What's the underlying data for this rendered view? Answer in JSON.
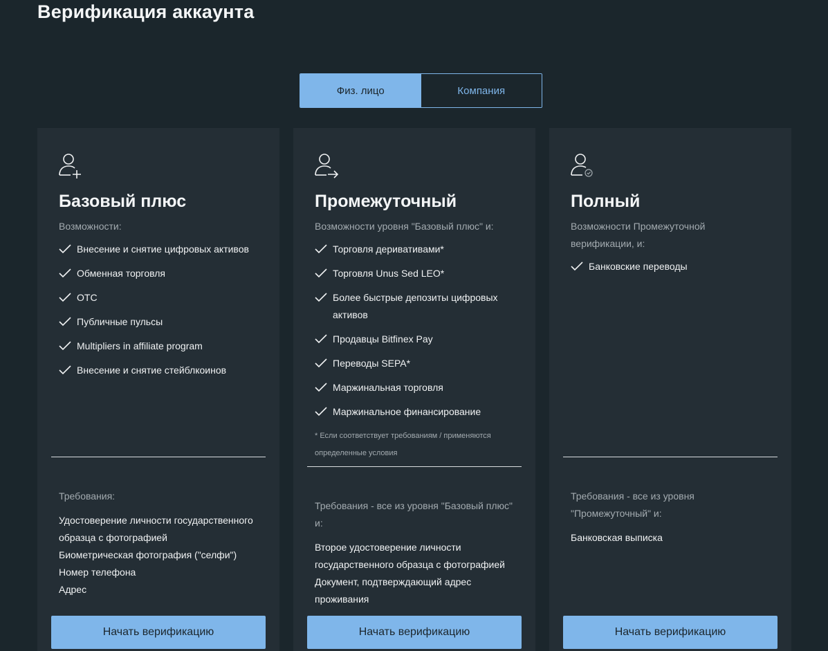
{
  "page": {
    "title": "Верификация аккаунта"
  },
  "tabs": [
    {
      "label": "Физ. лицо",
      "active": true
    },
    {
      "label": "Компания",
      "active": false
    }
  ],
  "colors": {
    "background": "#1b262c",
    "card": "#242e35",
    "accent": "#7fb6ea"
  },
  "cards": [
    {
      "icon": "user-plus-icon",
      "title": "Базовый плюс",
      "subtitle": "Возможности:",
      "features": [
        "Внесение и снятие цифровых активов",
        "Обменная торговля",
        "OTC",
        "Публичные пульсы",
        "Multipliers in affiliate program",
        "Внесение и снятие стейблкоинов"
      ],
      "footnote": "",
      "requirements_title": "Требования:",
      "requirements": [
        "Удостоверение личности государственного образца с фотографией",
        "Биометрическая фотография (\"селфи\")",
        "Номер телефона",
        "Адрес"
      ],
      "button": "Начать верификацию"
    },
    {
      "icon": "user-arrow-icon",
      "title": "Промежуточный",
      "subtitle": "Возможности уровня \"Базовый плюс\" и:",
      "features": [
        "Торговля деривативами*",
        "Торговля Unus Sed LEO*",
        "Более быстрые депозиты цифровых активов",
        "Продавцы Bitfinex Pay",
        "Переводы SEPA*",
        "Маржинальная торговля",
        "Маржинальное финансирование"
      ],
      "footnote": "* Если соответствует требованиям / применяются определенные условия",
      "requirements_title": "Требования - все из уровня \"Базовый плюс\" и:",
      "requirements": [
        "Второе удостоверение личности государственного образца с фотографией",
        "Документ, подтверждающий адрес проживания"
      ],
      "button": "Начать верификацию"
    },
    {
      "icon": "user-check-icon",
      "title": "Полный",
      "subtitle": "Возможности Промежуточной верификации, и:",
      "features": [
        "Банковские переводы"
      ],
      "footnote": "",
      "requirements_title": "Требования - все из уровня \"Промежуточный\" и:",
      "requirements": [
        "Банковская выписка"
      ],
      "button": "Начать верификацию"
    }
  ]
}
